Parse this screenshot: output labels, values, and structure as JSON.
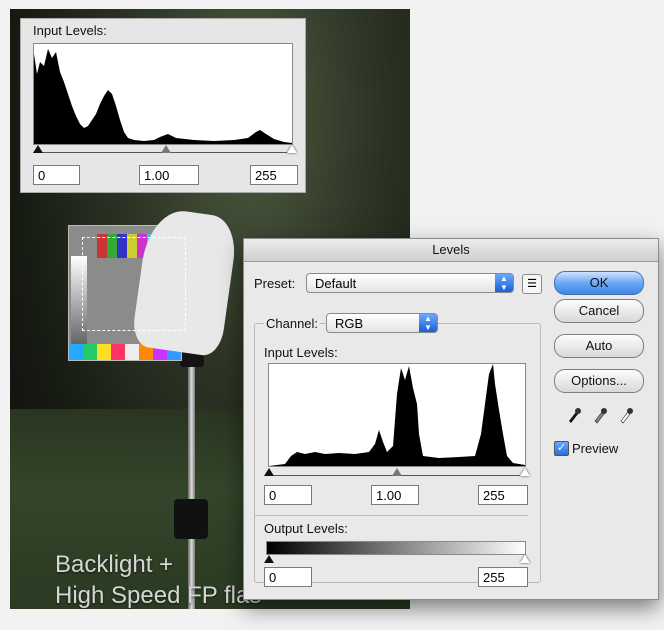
{
  "photo": {
    "caption_line1": "Backlight +",
    "caption_line2": "High Speed FP flas"
  },
  "inset": {
    "title": "Input Levels:",
    "black_input": "0",
    "gamma_input": "1.00",
    "white_input": "255"
  },
  "dialog": {
    "title": "Levels",
    "preset_label": "Preset:",
    "preset_value": "Default",
    "channel_label": "Channel:",
    "channel_value": "RGB",
    "input_levels_label": "Input Levels:",
    "input_black": "0",
    "input_gamma": "1.00",
    "input_white": "255",
    "output_levels_label": "Output Levels:",
    "output_black": "0",
    "output_white": "255",
    "buttons": {
      "ok": "OK",
      "cancel": "Cancel",
      "auto": "Auto",
      "options": "Options..."
    },
    "preview_label": "Preview",
    "preview_checked": true,
    "accent_color": "#3d86e6"
  },
  "icons": {
    "preset_menu": "list-menu-icon",
    "black_eyedropper": "eyedropper-icon",
    "gray_eyedropper": "eyedropper-icon",
    "white_eyedropper": "eyedropper-icon"
  }
}
